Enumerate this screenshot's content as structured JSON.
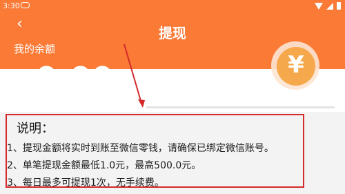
{
  "status_bar": {
    "time": "3:30"
  },
  "header": {
    "title": "提现",
    "balance_label": "我的余额"
  },
  "balance": {
    "currency_symbol": "¥",
    "amount": "0.00"
  },
  "coin": {
    "symbol": "¥"
  },
  "notes": {
    "title": "说明：",
    "items": [
      "1、提现金额将实时到账至微信零钱，请确保已绑定微信账号。",
      "2、单笔提现金额最低1.0元，最高500.0元。",
      "3、每日最多可提现1次，无手续费。"
    ]
  },
  "colors": {
    "header_bg": "#fa7a36",
    "coin": "#f6a84c",
    "annotation": "#d42a2a"
  },
  "icons": [
    "back-arrow-icon",
    "wifi-icon",
    "signal-icon",
    "battery-icon",
    "gamepad-icon",
    "yen-coin-icon"
  ]
}
